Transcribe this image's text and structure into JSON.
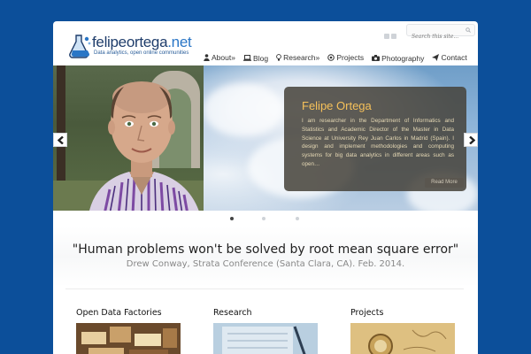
{
  "logo": {
    "name": "felipeortega",
    "tld": ".net",
    "tagline": "Data analytics, open online communities"
  },
  "search": {
    "placeholder": "Search this site..."
  },
  "nav": [
    {
      "label": "About»",
      "icon": "person-icon"
    },
    {
      "label": "Blog",
      "icon": "laptop-icon"
    },
    {
      "label": "Research»",
      "icon": "lightbulb-icon"
    },
    {
      "label": "Projects",
      "icon": "target-icon"
    },
    {
      "label": "Photography",
      "icon": "camera-icon"
    },
    {
      "label": "Contact",
      "icon": "send-icon"
    }
  ],
  "slide": {
    "title": "Felipe Ortega",
    "body": "I am researcher in the Department of Informatics and Statistics and Academic Director of the Master in Data Science at University Rey Juan Carlos in Madrid (Spain). I design and implement methodologies and computing systems for big data analytics in different areas such as open…",
    "more": "Read More",
    "active_index": 0,
    "count": 3
  },
  "quote": {
    "text": "\"Human problems won't be solved by root mean square error\"",
    "source": "Drew Conway, Strata Conference (Santa Clara, CA). Feb. 2014."
  },
  "cards": [
    {
      "title": "Open Data Factories"
    },
    {
      "title": "Research"
    },
    {
      "title": "Projects"
    }
  ],
  "colors": {
    "background": "#0c4f9a",
    "accent": "#f6c15a",
    "caption_bg": "#46423a"
  }
}
